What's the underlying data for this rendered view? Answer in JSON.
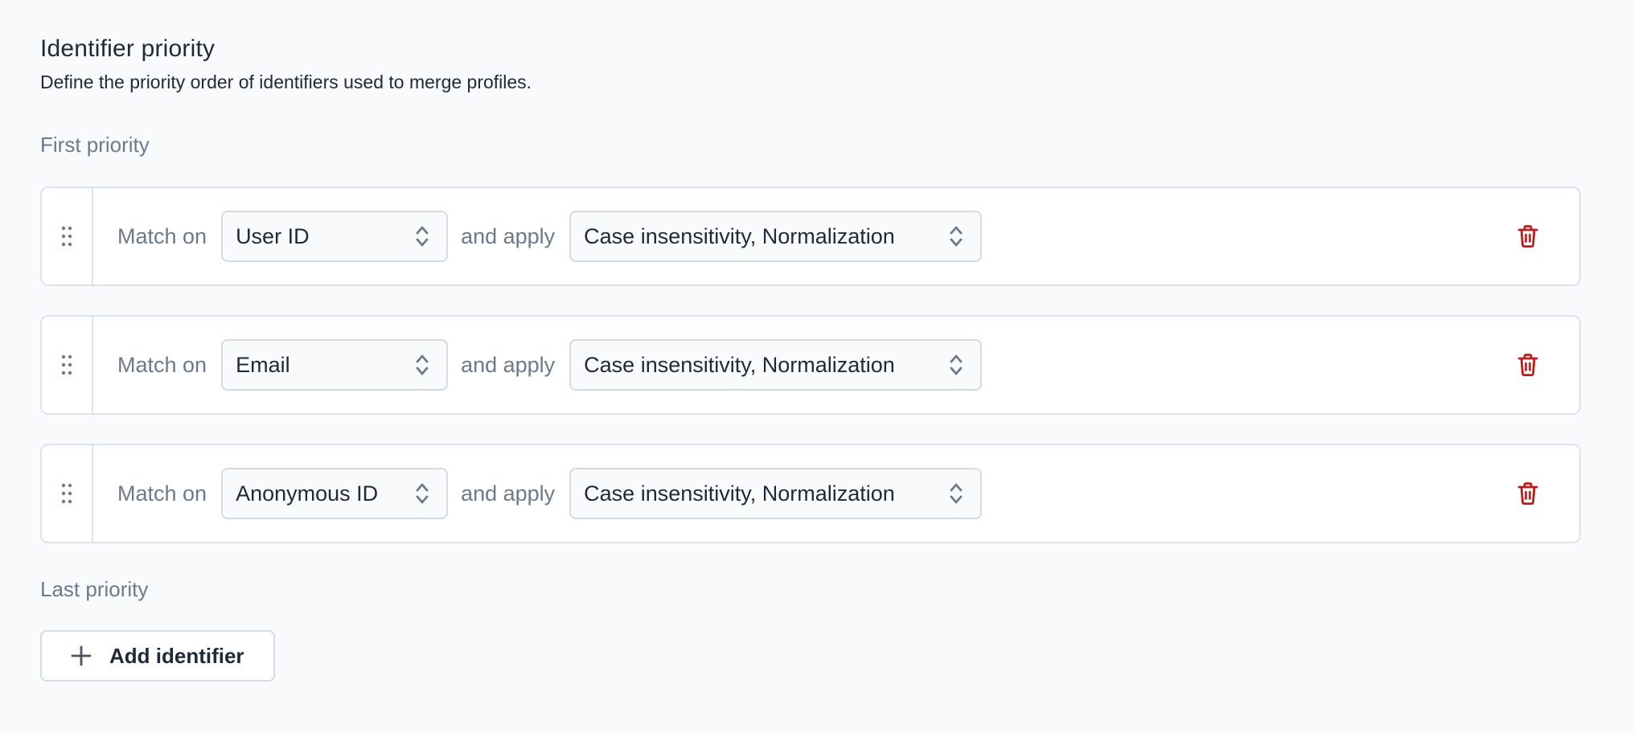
{
  "header": {
    "title": "Identifier priority",
    "description": "Define the priority order of identifiers used to merge profiles."
  },
  "labels": {
    "first_priority": "First priority",
    "last_priority": "Last priority",
    "match_on": "Match on",
    "and_apply": "and apply"
  },
  "rules": [
    {
      "identifier": "User ID",
      "transforms": "Case insensitivity, Normalization"
    },
    {
      "identifier": "Email",
      "transforms": "Case insensitivity, Normalization"
    },
    {
      "identifier": "Anonymous ID",
      "transforms": "Case insensitivity, Normalization"
    }
  ],
  "actions": {
    "add_identifier": "Add identifier"
  },
  "icons": {
    "drag": "drag-handle-icon",
    "chevrons": "chevron-up-down-icon",
    "delete": "trash-icon",
    "add": "plus-icon"
  },
  "colors": {
    "delete": "#b91c1c",
    "muted_text": "#6b7a8c",
    "border": "#dde3ea",
    "background": "#f9fafc"
  }
}
